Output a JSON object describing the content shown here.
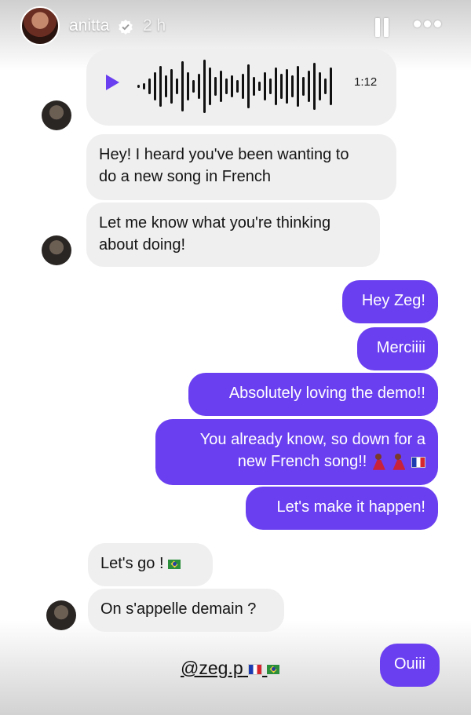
{
  "header": {
    "username": "anitta",
    "time": "2 h"
  },
  "voice_message": {
    "duration": "1:12"
  },
  "messages": [
    {
      "side": "in",
      "text": "Hey! I heard you've been wanting to",
      "text2": "do a new song in French"
    },
    {
      "side": "in",
      "text": "Let me know what you're thinking",
      "text2": "about doing!"
    },
    {
      "side": "out",
      "text": "Hey Zeg!"
    },
    {
      "side": "out",
      "text": "Merciiii"
    },
    {
      "side": "out",
      "text": "Absolutely loving the demo!!"
    },
    {
      "side": "out",
      "text": "You already know, so down for a",
      "text2": "new French song!!"
    },
    {
      "side": "out",
      "text": "Let's make it happen!"
    },
    {
      "side": "in",
      "text": "Let's go !"
    },
    {
      "side": "in",
      "text": "On s'appelle demain ?"
    },
    {
      "side": "out",
      "text": "Ouiii"
    }
  ],
  "tag": {
    "handle": "@zeg.p"
  },
  "icons": [
    "verified-badge-icon",
    "pause-icon",
    "more-icon",
    "play-icon",
    "waveform-icon",
    "dancer-emoji-icon",
    "france-flag-icon",
    "brazil-flag-icon"
  ]
}
